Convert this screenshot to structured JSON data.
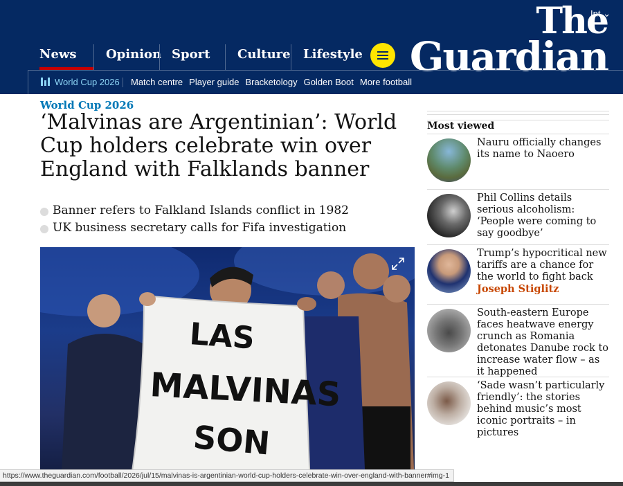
{
  "header": {
    "edition": "Int",
    "logo": {
      "line1": "The",
      "line2": "Guardian"
    },
    "pillars": [
      "News",
      "Opinion",
      "Sport",
      "Culture",
      "Lifestyle"
    ],
    "active_pillar": "News",
    "subnav": {
      "brand": "World Cup 2026",
      "links": [
        "Match centre",
        "Player guide",
        "Bracketology",
        "Golden Boot",
        "More football"
      ]
    }
  },
  "article": {
    "kicker": "World Cup 2026",
    "headline": "‘Malvinas are Argentinian’: World Cup holders celebrate win over England with Falklands banner",
    "standfirst": [
      "Banner refers to Falkland Islands conflict in 1982",
      "UK business secretary calls for Fifa investigation"
    ],
    "image": {
      "banner_text": [
        "LAS",
        "MALVINAS",
        "SON"
      ]
    }
  },
  "most_viewed": {
    "title": "Most viewed",
    "items": [
      {
        "text": "Nauru officially changes its name to Naoero",
        "byline": ""
      },
      {
        "text": "Phil Collins details serious alcoholism: ‘People were coming to say goodbye’",
        "byline": ""
      },
      {
        "text": "Trump’s hypocritical new tariffs are a chance for the world to fight back",
        "byline": "Joseph Stiglitz"
      },
      {
        "text": "South-eastern Europe faces heatwave energy crunch as Romania detonates Danube rock to increase water flow – as it happened",
        "byline": ""
      },
      {
        "text": "‘Sade wasn’t particularly friendly’: the stories behind music’s most iconic portraits – in pictures",
        "byline": ""
      }
    ]
  },
  "status_bar": {
    "url": "https://www.theguardian.com/football/2026/jul/15/malvinas-is-argentinian-world-cup-holders-celebrate-win-over-england-with-banner#img-1"
  },
  "colors": {
    "brand": "#052962",
    "accent_red": "#c70000",
    "menu_yellow": "#ffe500",
    "kicker_blue": "#0077b6",
    "byline_orange": "#c74600"
  }
}
